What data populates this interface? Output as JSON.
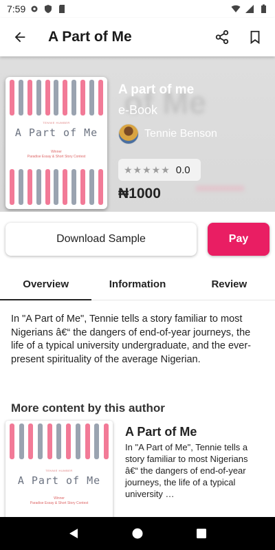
{
  "status_bar": {
    "time": "7:59"
  },
  "app_bar": {
    "title": "A Part of Me"
  },
  "book": {
    "title": "A part of me",
    "type": "e-Book",
    "author": "Tennie Benson",
    "rating": "0.0",
    "stars": "★★★★★",
    "price": "₦1000",
    "cover": {
      "small_text": "TENNIE HUMBER",
      "title": "A Part of Me",
      "subtitle_line1": "Winner",
      "subtitle_line2": "Paradise Essay & Short Story Contest"
    }
  },
  "actions": {
    "sample_label": "Download Sample",
    "pay_label": "Pay"
  },
  "tabs": [
    {
      "label": "Overview"
    },
    {
      "label": "Information"
    },
    {
      "label": "Review"
    }
  ],
  "overview_text": "In \"A Part of Me\", Tennie tells a story familiar to most Nigerians â€“ the dangers of end-of-year journeys, the life of a typical university undergraduate, and the ever-present spirituality of the average Nigerian.",
  "more": {
    "heading": "More content by this author",
    "item_title": "A Part of Me",
    "item_desc": "In \"A Part of Me\", Tennie tells a story familiar to most Nigerians â€“ the dangers of end-of-year journeys, the life of a typical university …"
  },
  "colors": {
    "accent": "#e91e63",
    "stripe_pink": "#f27a97",
    "stripe_gray": "#9aa3b0"
  }
}
